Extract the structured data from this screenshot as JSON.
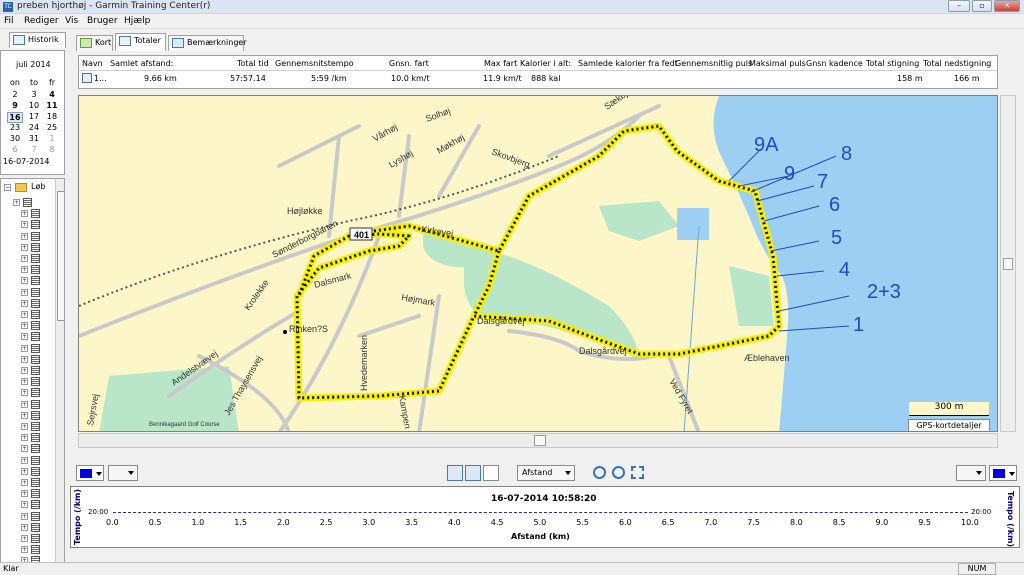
{
  "window": {
    "title": "preben hjorthøj - Garmin Training Center(r)",
    "app_icon": "TC"
  },
  "menu": [
    "Fil",
    "Rediger",
    "Vis",
    "Bruger",
    "Hjælp"
  ],
  "left_tab": "Historik",
  "calendar": {
    "month": "juli 2014",
    "day_headers": [
      "on",
      "to",
      "fr"
    ],
    "weeks": [
      [
        "2",
        "3",
        "4"
      ],
      [
        "9",
        "10",
        "11"
      ],
      [
        "16",
        "17",
        "18"
      ],
      [
        "23",
        "24",
        "25"
      ],
      [
        "30",
        "31",
        "1"
      ],
      [
        "6",
        "7",
        "8"
      ]
    ],
    "selected_date": "16-07-2014"
  },
  "tree": {
    "root_label": "Løb"
  },
  "tabs": [
    "Kort",
    "Totaler",
    "Bemærkninger"
  ],
  "table": {
    "headers": [
      "Navn",
      "Samlet afstand:",
      "Total tid",
      "Gennemsnitstempo",
      "Gnsn. fart",
      "Max fart",
      "Kalorier i alt:",
      "Samlede kalorier fra fedt",
      "Gennemsnitlig puls",
      "Maksimal puls",
      "Gnsn kadence",
      "Total stigning",
      "Total nedstigning"
    ],
    "row": [
      "1...",
      "9.66 km",
      "57:57.14",
      "5:59 /km",
      "10.0 km/t",
      "11.9 km/t",
      "888 kal",
      "",
      "",
      "",
      "",
      "158 m",
      "166 m"
    ]
  },
  "map": {
    "roads": [
      "Sækbjerg",
      "Solhøj",
      "Vårhøj",
      "Lyshøj",
      "Møkhøj",
      "Skovbjerg",
      "Højløkke",
      "Sønderborgbanen",
      "Kirkevej",
      "Dalsmark",
      "Højmark",
      "Krolekke",
      "Rinken?S",
      "Andelstvævej",
      "Jes Thaysensvej",
      "Hvedemarken",
      "Dalsgårdvej",
      "Dalsgårdvej",
      "Ved Fyret",
      "Æblehaven",
      "Kampen",
      "Sejrsvej",
      "Bennikagaard Golf Course"
    ],
    "road_number": "401",
    "annotations": [
      "9A",
      "9",
      "8",
      "7",
      "6",
      "5",
      "4",
      "2+3",
      "1"
    ],
    "scale": "300 m",
    "gps_button": "GPS-kortdetaljer"
  },
  "graph_toolbar": {
    "axis_select": "Afstand"
  },
  "graph": {
    "timestamp": "16-07-2014 10:58:20",
    "y_left_label": "Tempo (/km)",
    "y_right_label": "Tempo (/km)",
    "y_value": "20:00",
    "x_label": "Afstand (km)",
    "x_ticks": [
      "0.0",
      "0.5",
      "1.0",
      "1.5",
      "2.0",
      "2.5",
      "3.0",
      "3.5",
      "4.0",
      "4.5",
      "5.0",
      "5.5",
      "6.0",
      "6.5",
      "7.0",
      "7.5",
      "8.0",
      "8.5",
      "9.0",
      "9.5",
      "10.0"
    ]
  },
  "status": {
    "left": "Klar",
    "right": "NUM"
  }
}
